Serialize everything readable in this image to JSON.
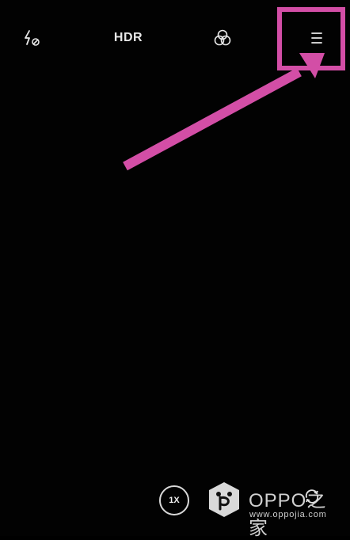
{
  "top_bar": {
    "flash_icon": "flash-off-icon",
    "hdr_label": "HDR",
    "filter_icon": "filter-icon",
    "menu_icon": "menu-icon"
  },
  "bottom": {
    "zoom_label": "1X",
    "watermark_brand": "OPPO",
    "watermark_suffix": "之家",
    "watermark_url": "www.oppojia.com",
    "switch_icon": "camera-switch-icon"
  },
  "colors": {
    "background": "#020202",
    "accent": "#d34ea6",
    "icon": "#e8e8e8"
  }
}
